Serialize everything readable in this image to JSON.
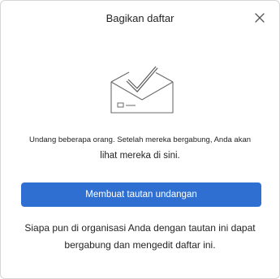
{
  "dialog": {
    "title": "Bagikan daftar",
    "close_icon": "close-icon",
    "illustration_icon": "envelope-checkmark-icon"
  },
  "invite": {
    "line1": "Undang beberapa orang. Setelah mereka bergabung, Anda akan",
    "line2": "lihat mereka di sini."
  },
  "actions": {
    "create_link_label": "Membuat tautan undangan",
    "button_color": "#2f6fd1"
  },
  "info": {
    "line1": "Siapa pun di organisasi Anda dengan tautan ini dapat",
    "line2": "bergabung dan mengedit daftar ini."
  }
}
